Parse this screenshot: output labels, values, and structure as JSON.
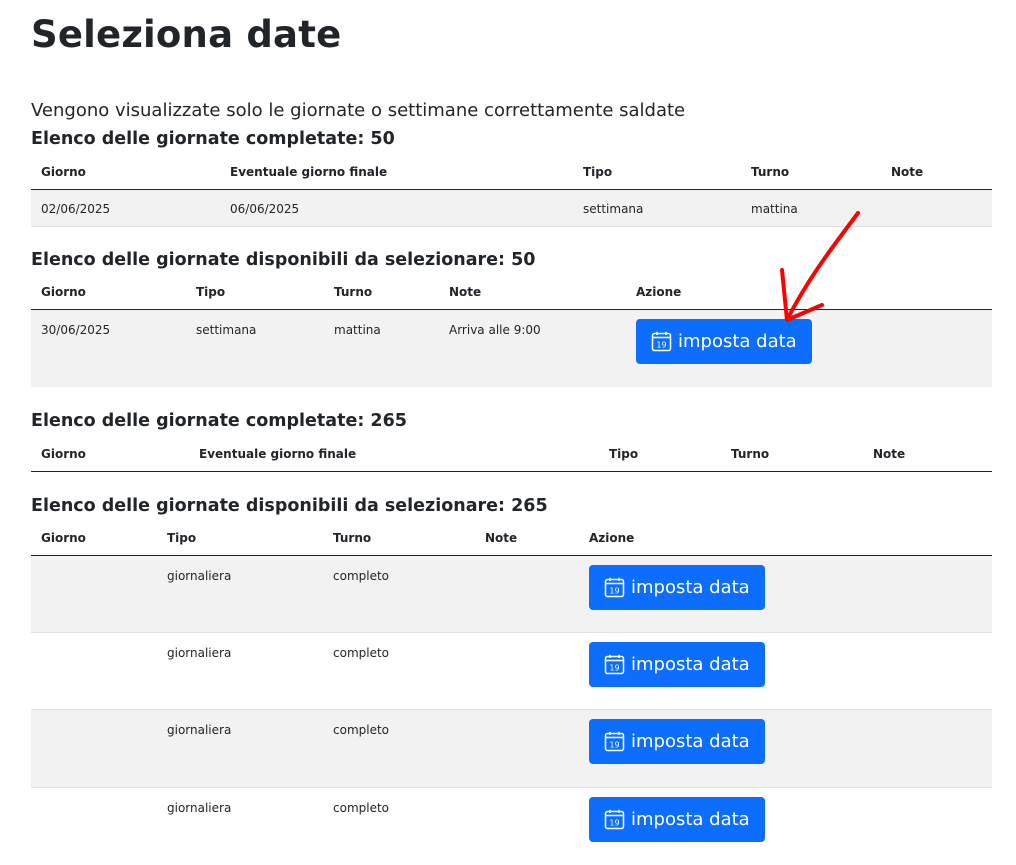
{
  "page_title": "Seleziona date",
  "intro_text": "Vengono visualizzate solo le giornate o settimane correttamente saldate",
  "section1": {
    "title": "Elenco delle giornate completate: 50",
    "headers": [
      "Giorno",
      "Eventuale giorno finale",
      "Tipo",
      "Turno",
      "Note"
    ],
    "rows": [
      {
        "giorno": "02/06/2025",
        "finale": "06/06/2025",
        "tipo": "settimana",
        "turno": "mattina",
        "note": ""
      }
    ]
  },
  "section2": {
    "title": "Elenco delle giornate disponibili da selezionare: 50",
    "headers": [
      "Giorno",
      "Tipo",
      "Turno",
      "Note",
      "Azione"
    ],
    "rows": [
      {
        "giorno": "30/06/2025",
        "tipo": "settimana",
        "turno": "mattina",
        "note": "Arriva alle 9:00",
        "action": "imposta data"
      }
    ]
  },
  "section3": {
    "title": "Elenco delle giornate completate: 265",
    "headers": [
      "Giorno",
      "Eventuale giorno finale",
      "Tipo",
      "Turno",
      "Note"
    ]
  },
  "section4": {
    "title": "Elenco delle giornate disponibili da selezionare: 265",
    "headers": [
      "Giorno",
      "Tipo",
      "Turno",
      "Note",
      "Azione"
    ],
    "rows": [
      {
        "giorno": "",
        "tipo": "giornaliera",
        "turno": "completo",
        "note": "",
        "action": "imposta data"
      },
      {
        "giorno": "",
        "tipo": "giornaliera",
        "turno": "completo",
        "note": "",
        "action": "imposta data"
      },
      {
        "giorno": "",
        "tipo": "giornaliera",
        "turno": "completo",
        "note": "",
        "action": "imposta data"
      },
      {
        "giorno": "",
        "tipo": "giornaliera",
        "turno": "completo",
        "note": "",
        "action": "imposta data"
      }
    ]
  },
  "icons": {
    "calendar": "calendar-icon",
    "calendar_day": "19"
  },
  "colors": {
    "button": "#0d6efd",
    "stripe": "#f2f2f2",
    "annotation_arrow": "#ff0000"
  }
}
